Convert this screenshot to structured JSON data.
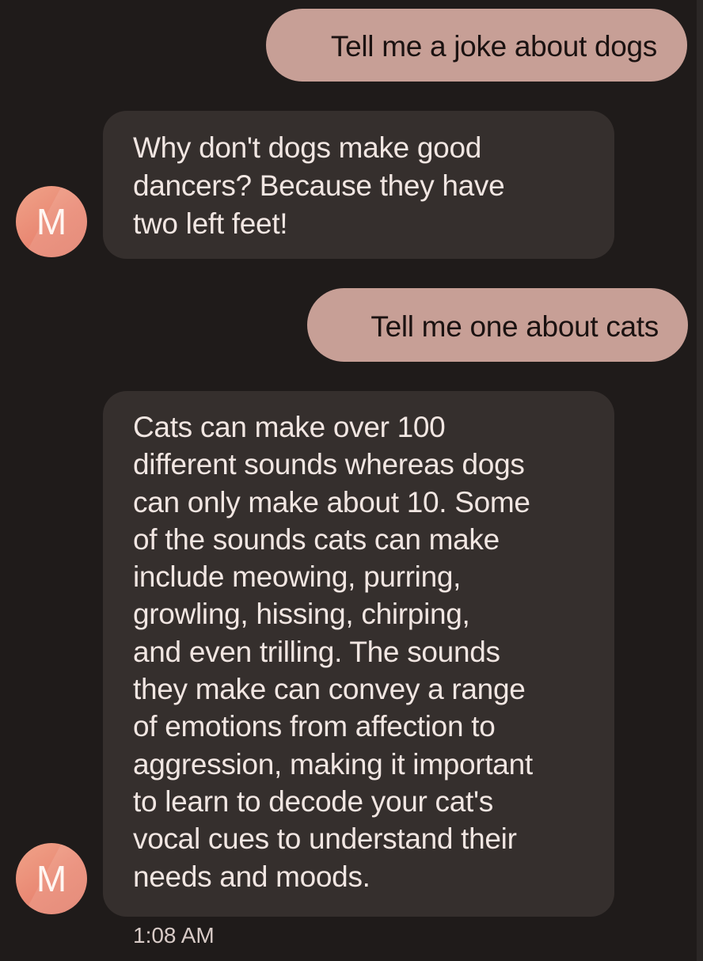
{
  "conversation": {
    "messages": [
      {
        "role": "user",
        "text": "Tell me a joke about dogs"
      },
      {
        "role": "assistant",
        "avatar_letter": "M",
        "lines": [
          "Why don't dogs make good",
          "dancers? Because they have",
          "two left feet!"
        ]
      },
      {
        "role": "user",
        "text": "Tell me one about cats"
      },
      {
        "role": "assistant",
        "avatar_letter": "M",
        "lines": [
          "Cats can make over 100",
          "different sounds whereas dogs",
          "can only make about 10. Some",
          "of the sounds cats can make",
          "include meowing, purring,",
          "growling, hissing, chirping,",
          "and even trilling. The sounds",
          "they make can convey a range",
          "of emotions from affection to",
          "aggression, making it important",
          "to learn to decode your cat's",
          "vocal cues to understand their",
          "needs and moods."
        ]
      }
    ],
    "timestamp": "1:08 AM"
  },
  "colors": {
    "background": "#1f1b1a",
    "user_bubble": "#c79f96",
    "assistant_bubble": "#352f2d",
    "avatar": "#e98873"
  },
  "icons": {
    "assistant_avatar": "letter-avatar-icon"
  }
}
